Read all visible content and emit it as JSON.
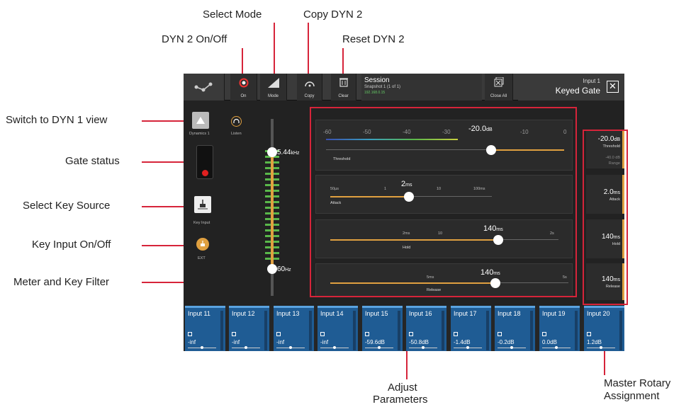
{
  "callouts": {
    "select_mode": "Select Mode",
    "copy_dyn2": "Copy DYN 2",
    "dyn2_onoff": "DYN 2 On/Off",
    "reset_dyn2": "Reset DYN 2",
    "switch_dyn1": "Switch to DYN 1 view",
    "gate_status": "Gate status",
    "select_key_source": "Select Key Source",
    "key_input_onoff": "Key Input On/Off",
    "meter_key_filter": "Meter and Key Filter",
    "adjust_params_1": "Adjust",
    "adjust_params_2": "Parameters",
    "master_rotary_1": "Master Rotary",
    "master_rotary_2": "Assignment"
  },
  "toolbar": {
    "on_label": "On",
    "mode_label": "Mode",
    "copy_label": "Copy",
    "clear_label": "Clear",
    "session_title": "Session",
    "snapshot": "Snapshot 1 (1 of 1)",
    "ip": "192.168.0.15",
    "close_all_label": "Close All",
    "input_name": "Input 1",
    "mode_name": "Keyed Gate"
  },
  "left": {
    "dynamics1": "Dynamics 1",
    "listen": "Listen",
    "key_input": "Key Input",
    "ext": "EXT"
  },
  "filter": {
    "high": "5.44",
    "high_unit": "kHz",
    "low": "60",
    "low_unit": "Hz"
  },
  "threshold": {
    "scale": [
      "-60",
      "-50",
      "-40",
      "-30",
      "-10",
      "0"
    ],
    "value": "-20.0",
    "unit": "dB",
    "label": "Threshold"
  },
  "attack": {
    "scale": [
      "50µs",
      "1",
      "10",
      "100ms"
    ],
    "value": "2",
    "unit": "ms",
    "label": "Attack"
  },
  "hold": {
    "scale": [
      "2ms",
      "10",
      "2s"
    ],
    "value": "140",
    "unit": "ms",
    "label": "Hold"
  },
  "release": {
    "scale": [
      "5ms",
      "5s"
    ],
    "value": "140",
    "unit": "ms",
    "label": "Release"
  },
  "rotary": {
    "threshold_val": "-20.0",
    "threshold_unit": "dB",
    "threshold_lbl": "Threshold",
    "range_val": "-40.0 dB",
    "range_lbl": "Range",
    "attack_val": "2.0",
    "attack_unit": "ms",
    "attack_lbl": "Attack",
    "hold_val": "140",
    "hold_unit": "ms",
    "hold_lbl": "Hold",
    "release_val": "140",
    "release_unit": "ms",
    "release_lbl": "Release"
  },
  "strips": [
    {
      "name": "Input 11",
      "value": "-inf"
    },
    {
      "name": "Input 12",
      "value": "-inf"
    },
    {
      "name": "Input 13",
      "value": "-inf"
    },
    {
      "name": "Input 14",
      "value": "-inf"
    },
    {
      "name": "Input 15",
      "value": "-59.6dB"
    },
    {
      "name": "Input 16",
      "value": "-50.8dB"
    },
    {
      "name": "Input 17",
      "value": "-1.4dB"
    },
    {
      "name": "Input 18",
      "value": "-0.2dB"
    },
    {
      "name": "Input 19",
      "value": "0.0dB"
    },
    {
      "name": "Input 20",
      "value": "1.2dB"
    }
  ],
  "colors": {
    "accent_orange": "#e0a040",
    "callout_red": "#d6243a",
    "strip_blue": "#1f5c94"
  }
}
